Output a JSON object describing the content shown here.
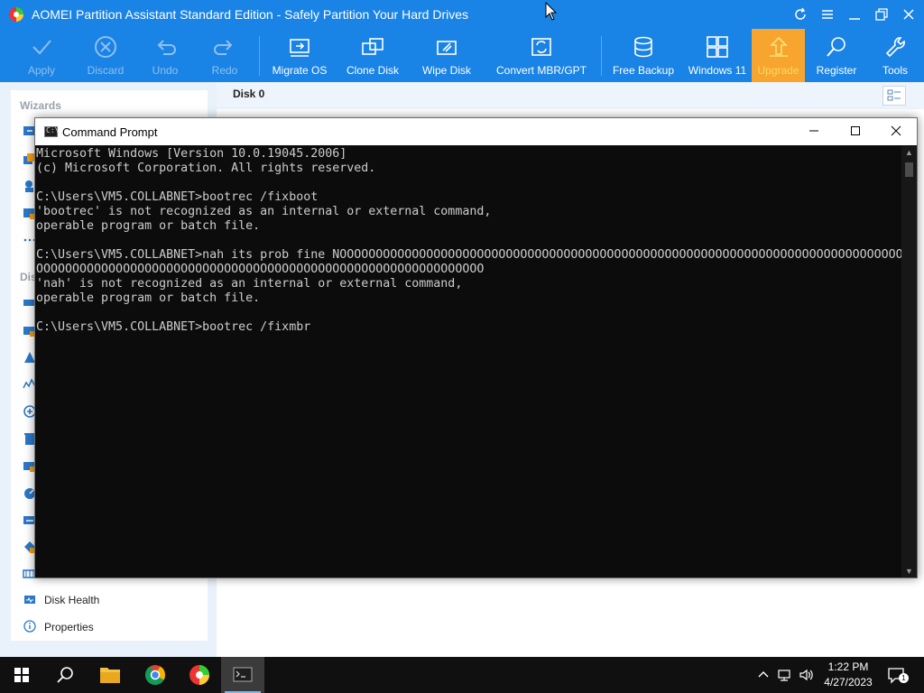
{
  "app": {
    "title": "AOMEI Partition Assistant Standard Edition - Safely Partition Your Hard Drives"
  },
  "toolbar": {
    "apply": "Apply",
    "discard": "Discard",
    "undo": "Undo",
    "redo": "Redo",
    "migrate_os": "Migrate OS",
    "clone_disk": "Clone Disk",
    "wipe_disk": "Wipe Disk",
    "convert": "Convert MBR/GPT",
    "free_backup": "Free Backup",
    "windows11": "Windows 11",
    "upgrade": "Upgrade",
    "register": "Register",
    "tools": "Tools"
  },
  "sidebar": {
    "wizards_heading": "Wizards",
    "disk_ops_heading": "Disk",
    "bottom_items": [
      {
        "label": "Disk Health"
      },
      {
        "label": "Properties"
      }
    ]
  },
  "main": {
    "disk_label": "Disk 0"
  },
  "cmd": {
    "title": "Command Prompt",
    "icon_text": "C:\\_",
    "lines": [
      "Microsoft Windows [Version 10.0.19045.2006]",
      "(c) Microsoft Corporation. All rights reserved.",
      "",
      "C:\\Users\\VM5.COLLABNET>bootrec /fixboot",
      "'bootrec' is not recognized as an internal or external command,",
      "operable program or batch file.",
      "",
      "C:\\Users\\VM5.COLLABNET>nah its prob fine NOOOOOOOOOOOOOOOOOOOOOOOOOOOOOOOOOOOOOOOOOOOOOOOOOOOOOOOOOOOOOOOOOOOOOOOOOOOOOO",
      "OOOOOOOOOOOOOOOOOOOOOOOOOOOOOOOOOOOOOOOOOOOOOOOOOOOOOOOOOOOOOO",
      "'nah' is not recognized as an internal or external command,",
      "operable program or batch file.",
      "",
      "C:\\Users\\VM5.COLLABNET>bootrec /fixmbr"
    ]
  },
  "taskbar": {
    "time": "1:22 PM",
    "date": "4/27/2023",
    "notification_count": "1"
  },
  "colors": {
    "titlebar": "#1a83e6",
    "upgrade_bg": "#f7a52f",
    "console_bg": "#0c0c0c",
    "console_text": "#cccccc",
    "taskbar": "#101010"
  }
}
